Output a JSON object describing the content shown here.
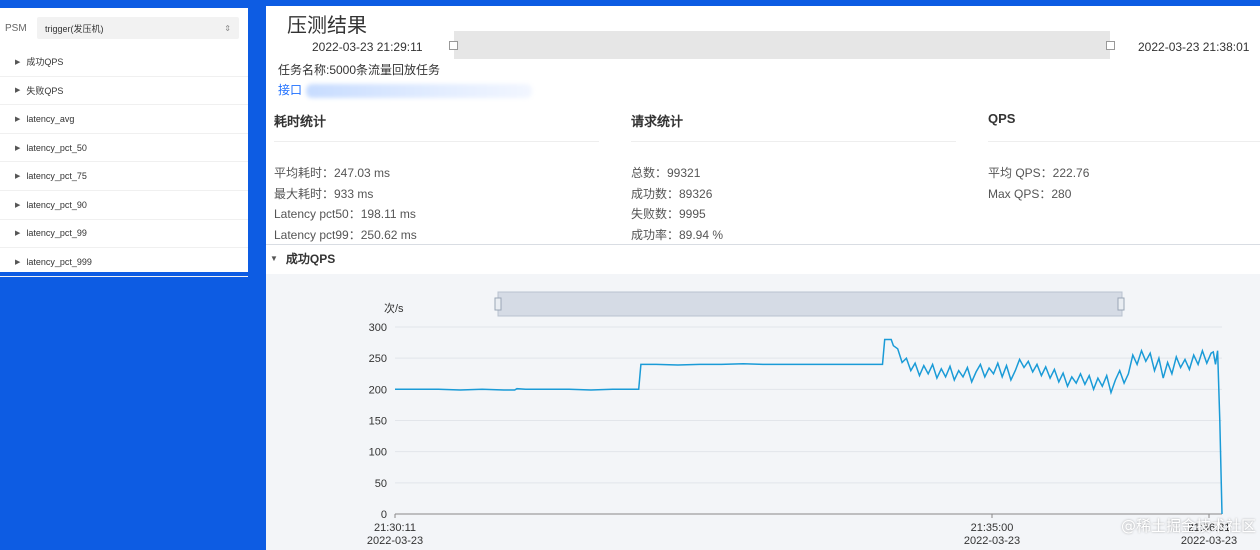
{
  "sidebar": {
    "psm_label": "PSM",
    "psm_value": "trigger(发压机)",
    "items": [
      {
        "label": "成功QPS"
      },
      {
        "label": "失败QPS"
      },
      {
        "label": "latency_avg"
      },
      {
        "label": "latency_pct_50"
      },
      {
        "label": "latency_pct_75"
      },
      {
        "label": "latency_pct_90"
      },
      {
        "label": "latency_pct_99"
      },
      {
        "label": "latency_pct_999"
      }
    ]
  },
  "header": {
    "title": "压测结果",
    "start_time": "2022-03-23 21:29:11",
    "end_time": "2022-03-23 21:38:01",
    "task_name": "任务名称:5000条流量回放任务",
    "interface_label": "接口"
  },
  "stats": {
    "latency": {
      "title": "耗时统计",
      "lines": [
        "平均耗时：247.03 ms",
        "最大耗时：933 ms",
        "Latency pct50：198.11 ms",
        "Latency pct99：250.62 ms"
      ]
    },
    "requests": {
      "title": "请求统计",
      "lines": [
        "总数：99321",
        "成功数：89326",
        "失败数：9995",
        "成功率：89.94 %"
      ]
    },
    "qps": {
      "title": "QPS",
      "lines": [
        "平均 QPS：222.76",
        "Max QPS：280"
      ]
    }
  },
  "chart_section": {
    "title": "成功QPS"
  },
  "chart_data": {
    "type": "line",
    "ylabel": "次/s",
    "ylim": [
      0,
      300
    ],
    "yticks": [
      0,
      50,
      100,
      150,
      200,
      250,
      300
    ],
    "x_tick_labels": [
      {
        "time": "21:30:11",
        "date": "2022-03-23"
      },
      {
        "time": "21:35:00",
        "date": "2022-03-23"
      },
      {
        "time": "21:36:31",
        "date": "2022-03-23"
      }
    ],
    "x_domain_seconds": [
      0,
      380
    ],
    "series": [
      {
        "color": "#1a9bd7",
        "points": [
          [
            0,
            200
          ],
          [
            10,
            200
          ],
          [
            20,
            200
          ],
          [
            30,
            199
          ],
          [
            40,
            200
          ],
          [
            50,
            199
          ],
          [
            55,
            199
          ],
          [
            56,
            201
          ],
          [
            60,
            200
          ],
          [
            70,
            200
          ],
          [
            80,
            200
          ],
          [
            90,
            199
          ],
          [
            100,
            200
          ],
          [
            110,
            200
          ],
          [
            112,
            200
          ],
          [
            113,
            240
          ],
          [
            120,
            240
          ],
          [
            130,
            239
          ],
          [
            140,
            240
          ],
          [
            150,
            240
          ],
          [
            160,
            241
          ],
          [
            170,
            240
          ],
          [
            180,
            240
          ],
          [
            190,
            240
          ],
          [
            200,
            240
          ],
          [
            210,
            240
          ],
          [
            224,
            240
          ],
          [
            225,
            280
          ],
          [
            228,
            280
          ],
          [
            229,
            270
          ],
          [
            231,
            265
          ],
          [
            233,
            243
          ],
          [
            235,
            250
          ],
          [
            237,
            230
          ],
          [
            239,
            242
          ],
          [
            241,
            222
          ],
          [
            243,
            238
          ],
          [
            245,
            225
          ],
          [
            247,
            240
          ],
          [
            249,
            218
          ],
          [
            251,
            233
          ],
          [
            253,
            220
          ],
          [
            255,
            237
          ],
          [
            257,
            215
          ],
          [
            259,
            230
          ],
          [
            261,
            220
          ],
          [
            263,
            235
          ],
          [
            265,
            212
          ],
          [
            267,
            228
          ],
          [
            269,
            240
          ],
          [
            271,
            220
          ],
          [
            273,
            234
          ],
          [
            275,
            225
          ],
          [
            277,
            242
          ],
          [
            279,
            220
          ],
          [
            281,
            238
          ],
          [
            283,
            215
          ],
          [
            285,
            230
          ],
          [
            287,
            248
          ],
          [
            289,
            235
          ],
          [
            291,
            245
          ],
          [
            293,
            228
          ],
          [
            295,
            240
          ],
          [
            297,
            222
          ],
          [
            299,
            236
          ],
          [
            301,
            218
          ],
          [
            303,
            232
          ],
          [
            305,
            212
          ],
          [
            307,
            226
          ],
          [
            309,
            205
          ],
          [
            311,
            220
          ],
          [
            313,
            210
          ],
          [
            315,
            225
          ],
          [
            317,
            208
          ],
          [
            319,
            222
          ],
          [
            321,
            200
          ],
          [
            323,
            218
          ],
          [
            325,
            205
          ],
          [
            327,
            222
          ],
          [
            329,
            195
          ],
          [
            331,
            215
          ],
          [
            333,
            230
          ],
          [
            335,
            210
          ],
          [
            337,
            225
          ],
          [
            339,
            255
          ],
          [
            341,
            240
          ],
          [
            343,
            262
          ],
          [
            345,
            245
          ],
          [
            347,
            258
          ],
          [
            349,
            230
          ],
          [
            351,
            250
          ],
          [
            353,
            218
          ],
          [
            355,
            243
          ],
          [
            357,
            225
          ],
          [
            359,
            252
          ],
          [
            361,
            235
          ],
          [
            363,
            248
          ],
          [
            365,
            232
          ],
          [
            367,
            255
          ],
          [
            369,
            240
          ],
          [
            371,
            262
          ],
          [
            373,
            242
          ],
          [
            375,
            258
          ],
          [
            376,
            260
          ],
          [
            377,
            240
          ],
          [
            378,
            262
          ],
          [
            379,
            150
          ],
          [
            380,
            0
          ]
        ]
      }
    ]
  },
  "watermark": "@稀土掘金技术社区"
}
